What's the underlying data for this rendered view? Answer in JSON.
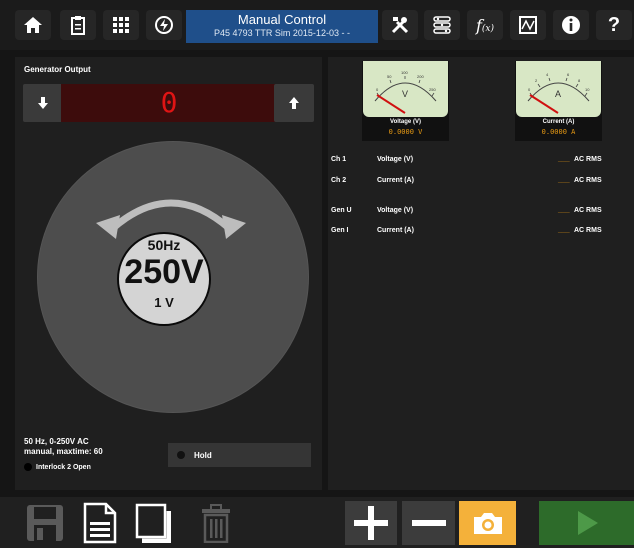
{
  "header": {
    "title": "Manual Control",
    "subtitle": "P45 4793 TTR Sim 2015-12-03 - -",
    "left_icons": [
      "home-icon",
      "clipboard-icon",
      "grid-icon",
      "power-icon"
    ],
    "right_icons": [
      "tools-icon",
      "settings-list-icon",
      "function-icon",
      "waveform-icon",
      "info-icon",
      "help-icon"
    ],
    "function_label": "f",
    "function_sub": "(x)"
  },
  "generator": {
    "label": "Generator Output",
    "display_value": "0",
    "knob_freq": "50Hz",
    "knob_voltage": "250V",
    "knob_step": "1 V",
    "info_line1": "50 Hz, 0-250V AC",
    "info_line2": "manual, maxtime: 60",
    "interlock": "Interlock 2 Open",
    "hold_label": "Hold"
  },
  "meters": {
    "voltage": {
      "label": "Voltage (V)",
      "value": "0.0000 V",
      "unit": "V",
      "scale": [
        "0",
        "50",
        "100",
        "200",
        "250"
      ]
    },
    "current": {
      "label": "Current (A)",
      "value": "0.0000 A",
      "unit": "A",
      "scale": [
        "0",
        "2",
        "4",
        "6",
        "8",
        "10"
      ]
    }
  },
  "channels": [
    {
      "id": "Ch 1",
      "quantity": "Voltage (V)",
      "value": "___",
      "unit": "AC RMS"
    },
    {
      "id": "Ch 2",
      "quantity": "Current (A)",
      "value": "___",
      "unit": "AC RMS"
    },
    {
      "id": "Gen U",
      "quantity": "Voltage (V)",
      "value": "___",
      "unit": "AC RMS"
    },
    {
      "id": "Gen I",
      "quantity": "Current (A)",
      "value": "___",
      "unit": "AC RMS"
    }
  ],
  "toolbar": {
    "icons": [
      "save-icon",
      "document-icon",
      "copy-icon",
      "trash-icon",
      "plus-icon",
      "minus-icon",
      "camera-icon",
      "play-icon"
    ],
    "colors": {
      "camera": "#f4b13a",
      "play": "#2d6b2a",
      "title": "#1f4f8a",
      "display": "#e01414",
      "readout": "#e79a14"
    }
  }
}
